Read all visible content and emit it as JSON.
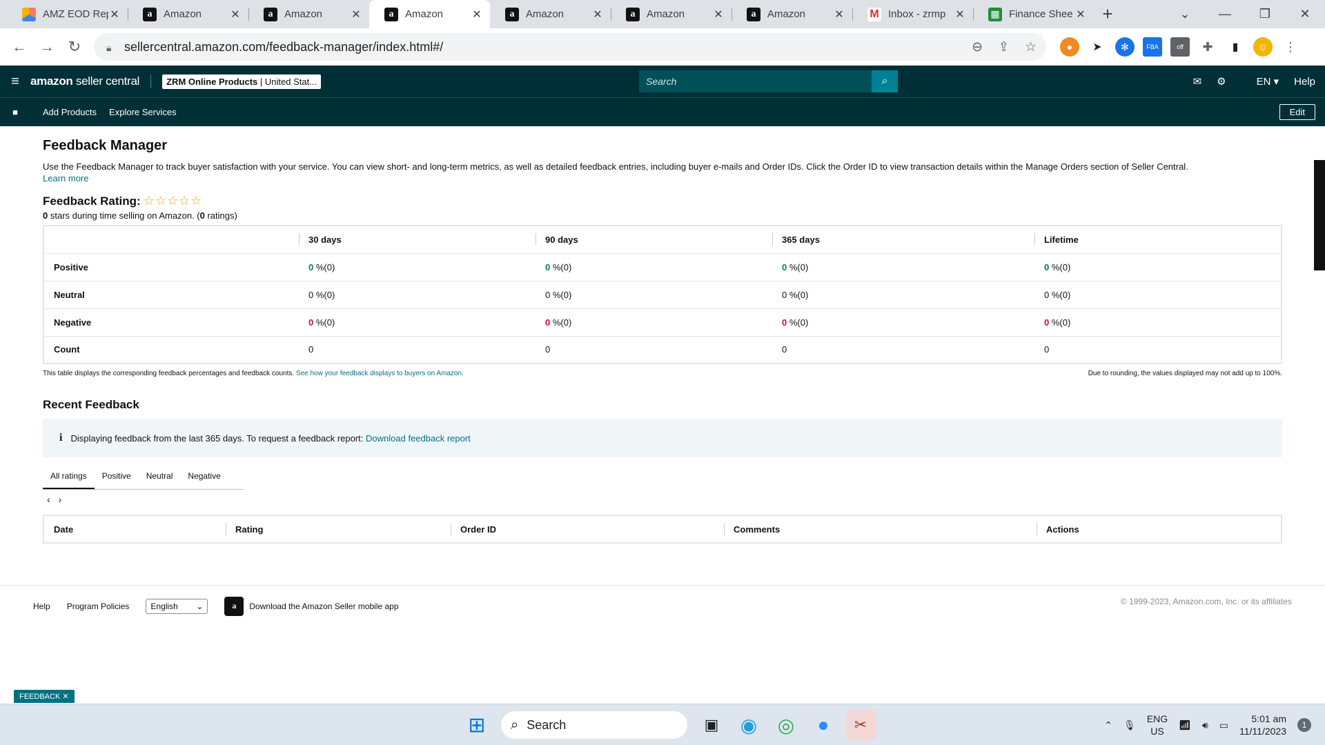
{
  "browser": {
    "tabs": [
      {
        "title": "AMZ EOD Rep",
        "icon": "asana-icon",
        "active": false
      },
      {
        "title": "Amazon",
        "icon": "amazon-icon",
        "active": false
      },
      {
        "title": "Amazon",
        "icon": "amazon-icon",
        "active": false
      },
      {
        "title": "Amazon",
        "icon": "amazon-icon",
        "active": true
      },
      {
        "title": "Amazon",
        "icon": "amazon-icon",
        "active": false
      },
      {
        "title": "Amazon",
        "icon": "amazon-icon",
        "active": false
      },
      {
        "title": "Amazon",
        "icon": "amazon-icon",
        "active": false
      },
      {
        "title": "Inbox - zrmp",
        "icon": "gmail-icon",
        "active": false
      },
      {
        "title": "Finance Shee",
        "icon": "sheets-icon",
        "active": false
      }
    ],
    "url": "sellercentral.amazon.com/feedback-manager/index.html#/"
  },
  "header": {
    "logo_bold": "amazon",
    "logo_rest": " seller central",
    "store_name": "ZRM Online Products",
    "store_region": " | United Stat...",
    "search_placeholder": "Search",
    "language": "EN",
    "help": "Help",
    "subnav": [
      "Add Products",
      "Explore Services"
    ],
    "edit": "Edit",
    "colors": {
      "header_bg": "#002f36",
      "search_btn": "#008296"
    }
  },
  "page": {
    "title": "Feedback Manager",
    "description": "Use the Feedback Manager to track buyer satisfaction with your service. You can view short- and long-term metrics, as well as detailed feedback entries, including buyer e-mails and Order IDs. Click the Order ID to view transaction details within the Manage Orders section of Seller Central.",
    "learn_more": "Learn more",
    "rating_label": "Feedback Rating:",
    "stars": "☆☆☆☆☆",
    "rating_stars_value": "0",
    "rating_stars_text": " stars during time selling on Amazon. (",
    "rating_count": "0",
    "rating_count_text": " ratings)"
  },
  "metrics": {
    "columns": [
      "",
      "30 days",
      "90 days",
      "365 days",
      "Lifetime"
    ],
    "rows": [
      {
        "label": "Positive",
        "type": "pos",
        "values": [
          [
            "0",
            " %(0)"
          ],
          [
            "0",
            " %(0)"
          ],
          [
            "0",
            " %(0)"
          ],
          [
            "0",
            " %(0)"
          ]
        ]
      },
      {
        "label": "Neutral",
        "type": "neu",
        "values": [
          [
            "0",
            " %(0)"
          ],
          [
            "0",
            " %(0)"
          ],
          [
            "0",
            " %(0)"
          ],
          [
            "0",
            " %(0)"
          ]
        ]
      },
      {
        "label": "Negative",
        "type": "neg",
        "values": [
          [
            "0",
            " %(0)"
          ],
          [
            "0",
            " %(0)"
          ],
          [
            "0",
            " %(0)"
          ],
          [
            "0",
            " %(0)"
          ]
        ]
      },
      {
        "label": "Count",
        "type": "count",
        "values": [
          [
            "0",
            ""
          ],
          [
            "0",
            ""
          ],
          [
            "0",
            ""
          ],
          [
            "0",
            ""
          ]
        ]
      }
    ],
    "note_left": "This table displays the corresponding feedback percentages and feedback counts.",
    "note_link": "See how your feedback displays to buyers on Amazon.",
    "note_right": "Due to rounding, the values displayed may not add up to 100%."
  },
  "recent": {
    "title": "Recent Feedback",
    "info_text": "Displaying feedback from the last 365 days. To request a feedback report:",
    "info_link": "Download feedback report",
    "tabs": [
      "All ratings",
      "Positive",
      "Neutral",
      "Negative"
    ],
    "active_tab": 0,
    "columns": [
      "Date",
      "Rating",
      "Order ID",
      "Comments",
      "Actions"
    ]
  },
  "footer": {
    "help": "Help",
    "policies": "Program Policies",
    "language": "English",
    "app": "Download the Amazon Seller mobile app",
    "copyright": "© 1999-2023, Amazon.com, Inc. or its affiliates",
    "feedback_badge": "FEEDBACK ✕"
  },
  "taskbar": {
    "search": "Search",
    "lang_top": "ENG",
    "lang_bottom": "US",
    "time": "5:01 am",
    "date": "11/11/2023",
    "notifications": "1"
  }
}
